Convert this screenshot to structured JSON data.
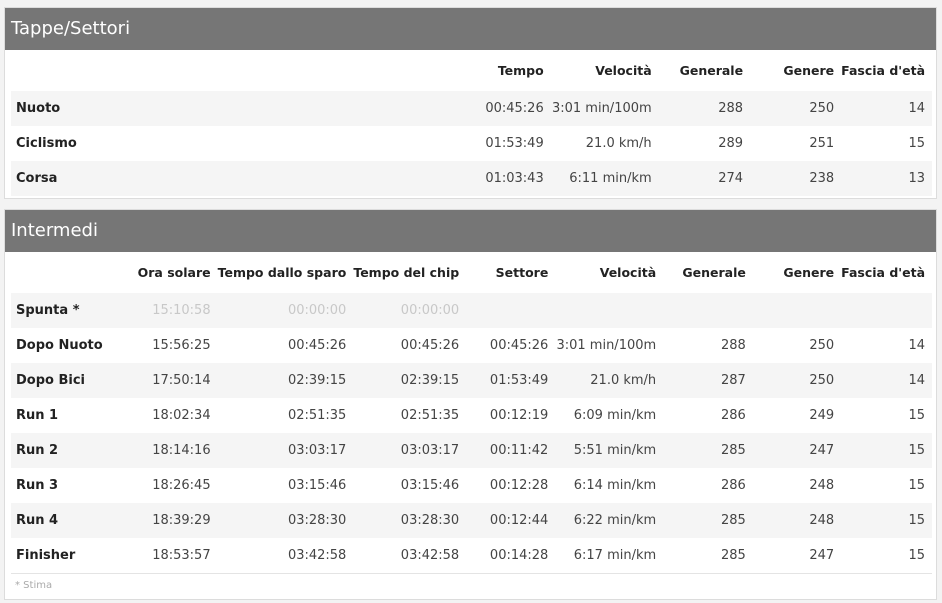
{
  "legs_panel": {
    "title": "Tappe/Settori",
    "headers": [
      "",
      "Tempo",
      "Velocità",
      "Generale",
      "Genere",
      "Fascia d'età"
    ],
    "rows": [
      {
        "name": "Nuoto",
        "time": "00:45:26",
        "speed": "3:01 min/100m",
        "overall": "288",
        "gender": "250",
        "age_group": "14"
      },
      {
        "name": "Ciclismo",
        "time": "01:53:49",
        "speed": "21.0 km/h",
        "overall": "289",
        "gender": "251",
        "age_group": "15"
      },
      {
        "name": "Corsa",
        "time": "01:03:43",
        "speed": "6:11 min/km",
        "overall": "274",
        "gender": "238",
        "age_group": "13"
      }
    ]
  },
  "splits_panel": {
    "title": "Intermedi",
    "headers": [
      "",
      "Ora solare",
      "Tempo dallo sparo",
      "Tempo del chip",
      "Settore",
      "Velocità",
      "Generale",
      "Genere",
      "Fascia d'età"
    ],
    "rows": [
      {
        "name": "Spunta *",
        "clock": "15:10:58",
        "gun": "00:00:00",
        "chip": "00:00:00",
        "leg": "",
        "speed": "",
        "overall": "",
        "gender": "",
        "age_group": ""
      },
      {
        "name": "Dopo Nuoto",
        "clock": "15:56:25",
        "gun": "00:45:26",
        "chip": "00:45:26",
        "leg": "00:45:26",
        "speed": "3:01 min/100m",
        "overall": "288",
        "gender": "250",
        "age_group": "14"
      },
      {
        "name": "Dopo Bici",
        "clock": "17:50:14",
        "gun": "02:39:15",
        "chip": "02:39:15",
        "leg": "01:53:49",
        "speed": "21.0 km/h",
        "overall": "287",
        "gender": "250",
        "age_group": "14"
      },
      {
        "name": "Run 1",
        "clock": "18:02:34",
        "gun": "02:51:35",
        "chip": "02:51:35",
        "leg": "00:12:19",
        "speed": "6:09 min/km",
        "overall": "286",
        "gender": "249",
        "age_group": "15"
      },
      {
        "name": "Run 2",
        "clock": "18:14:16",
        "gun": "03:03:17",
        "chip": "03:03:17",
        "leg": "00:11:42",
        "speed": "5:51 min/km",
        "overall": "285",
        "gender": "247",
        "age_group": "15"
      },
      {
        "name": "Run 3",
        "clock": "18:26:45",
        "gun": "03:15:46",
        "chip": "03:15:46",
        "leg": "00:12:28",
        "speed": "6:14 min/km",
        "overall": "286",
        "gender": "248",
        "age_group": "15"
      },
      {
        "name": "Run 4",
        "clock": "18:39:29",
        "gun": "03:28:30",
        "chip": "03:28:30",
        "leg": "00:12:44",
        "speed": "6:22 min/km",
        "overall": "285",
        "gender": "248",
        "age_group": "15"
      },
      {
        "name": "Finisher",
        "clock": "18:53:57",
        "gun": "03:42:58",
        "chip": "03:42:58",
        "leg": "00:14:28",
        "speed": "6:17 min/km",
        "overall": "285",
        "gender": "247",
        "age_group": "15"
      }
    ],
    "footnote": "* Stima"
  }
}
